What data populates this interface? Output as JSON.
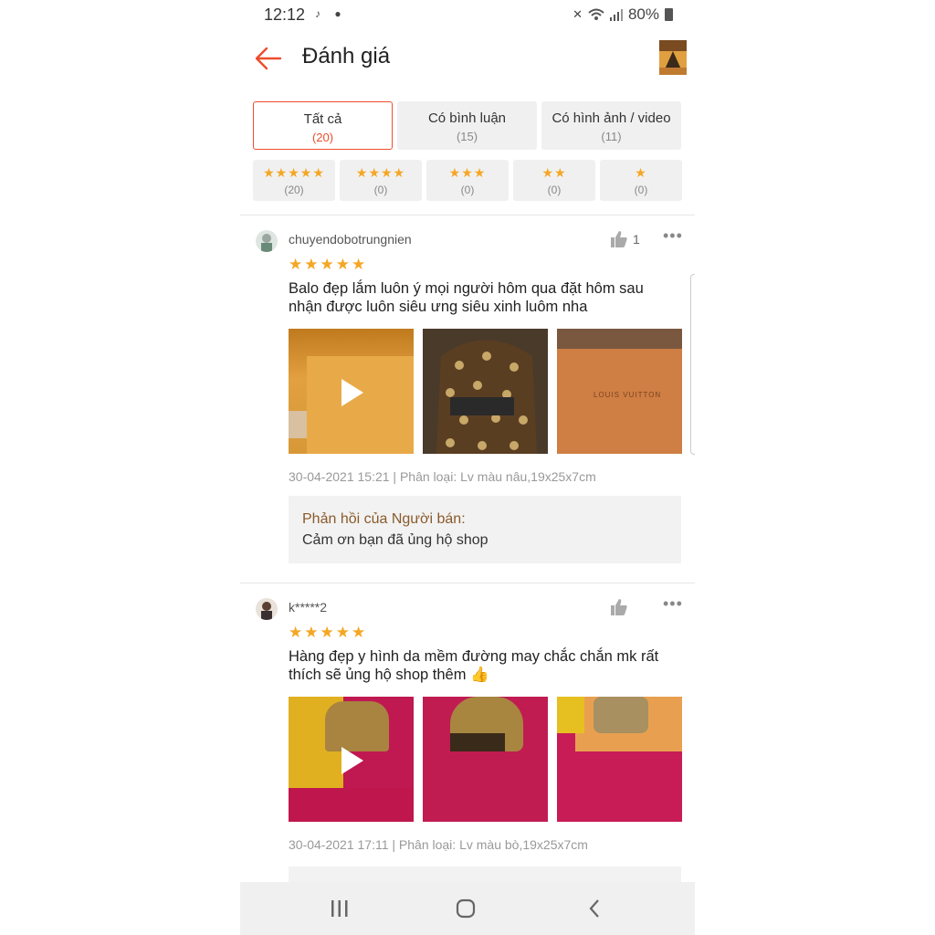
{
  "status": {
    "time": "12:12",
    "battery": "80%"
  },
  "header": {
    "title": "Đánh giá"
  },
  "tabs": [
    {
      "label": "Tất cả",
      "count": "(20)"
    },
    {
      "label": "Có bình luận",
      "count": "(15)"
    },
    {
      "label": "Có hình ảnh / video",
      "count": "(11)"
    }
  ],
  "star_filters": [
    {
      "stars": "★★★★★",
      "count": "(20)"
    },
    {
      "stars": "★★★★",
      "count": "(0)"
    },
    {
      "stars": "★★★",
      "count": "(0)"
    },
    {
      "stars": "★★",
      "count": "(0)"
    },
    {
      "stars": "★",
      "count": "(0)"
    }
  ],
  "reviews": [
    {
      "username": "chuyendobotrungnien",
      "likes": "1",
      "stars": "★★★★★",
      "text": "Balo đẹp lắm luôn ý mọi người hôm qua đặt hôm sau nhận được luôn siêu ưng siêu xinh luôm nha",
      "meta": "30-04-2021 15:21 | Phân loại: Lv màu nâu,19x25x7cm",
      "photo3_caption": "LOUIS VUITTON",
      "reply_heading": "Phản hồi của Người bán:",
      "reply_text": "Cảm ơn bạn đã ủng hộ shop"
    },
    {
      "username": "k*****2",
      "likes": "",
      "stars": "★★★★★",
      "text": "Hàng đẹp y hình da mềm đường may chắc chắn mk rất thích sẽ ủng hộ shop thêm 👍",
      "meta": "30-04-2021 17:11 | Phân loại: Lv màu bò,19x25x7cm"
    }
  ],
  "colors": {
    "accent": "#ee4d2d",
    "star": "#f5a623"
  }
}
